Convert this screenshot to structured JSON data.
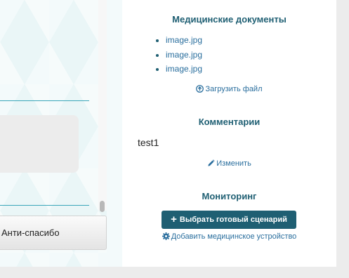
{
  "left": {
    "button_label": "Анти-спасибо"
  },
  "documents": {
    "title": "Медицинские документы",
    "files": [
      "image.jpg",
      "image.jpg",
      "image.jpg"
    ],
    "upload_label": "Загрузить файл"
  },
  "comments": {
    "title": "Комментарии",
    "text": "test1",
    "edit_label": "Изменить"
  },
  "monitoring": {
    "title": "Мониторинг",
    "scenario_button_label": "Выбрать готовый сценарий",
    "add_device_label": "Добавить медицинское устройство"
  },
  "colors": {
    "accent": "#1f5f73",
    "link": "#2b6f9e",
    "line": "#3aa6b9"
  },
  "icons": [
    "upload-circle-icon",
    "pencil-icon",
    "plus-icon",
    "gear-icon"
  ]
}
